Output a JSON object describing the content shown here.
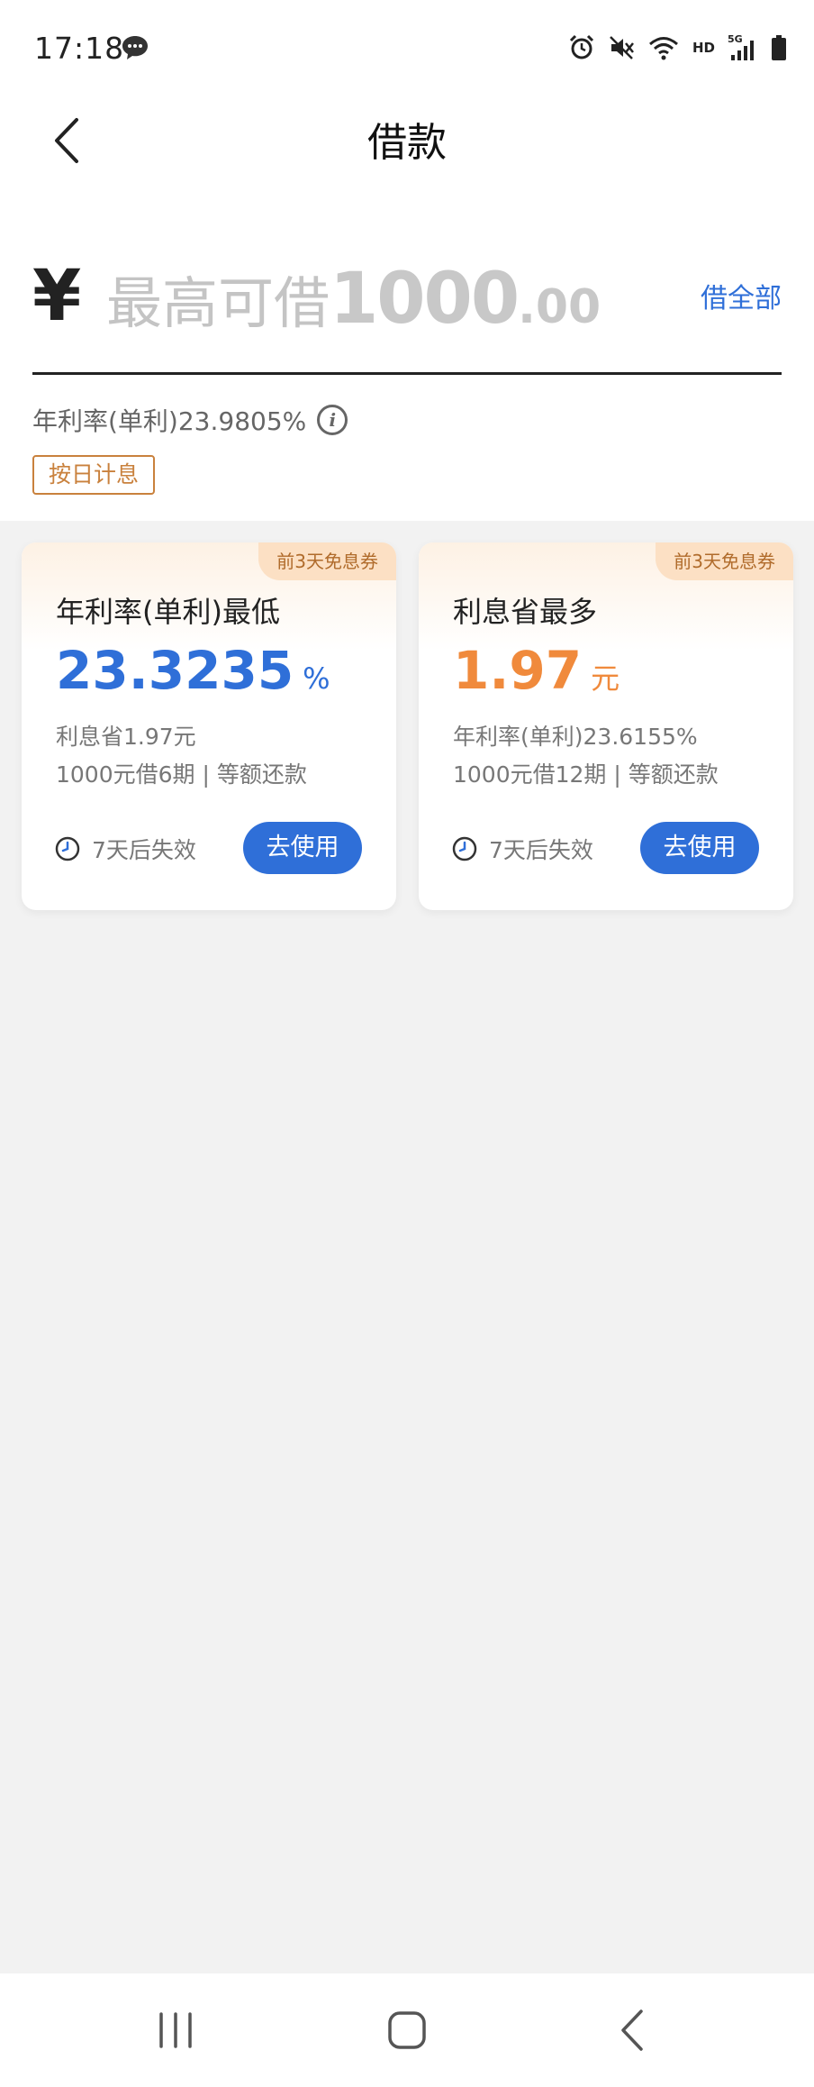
{
  "status_bar": {
    "time": "17:18",
    "network_label": "HD",
    "signal_label": "5G"
  },
  "nav": {
    "title": "借款"
  },
  "amount": {
    "currency_symbol": "¥",
    "placeholder_text": "最高可借",
    "placeholder_amount": "1000",
    "placeholder_decimal": ".00",
    "borrow_all_label": "借全部",
    "rate_text": "年利率(单利)23.9805%",
    "tag_label": "按日计息"
  },
  "cards": [
    {
      "badge": "前3天免息券",
      "title": "年利率(单利)最低",
      "main_value": "23.3235",
      "main_unit": "%",
      "line1": "利息省1.97元",
      "line2": "1000元借6期 | 等额还款",
      "expire": "7天后失效",
      "button": "去使用"
    },
    {
      "badge": "前3天免息券",
      "title": "利息省最多",
      "main_value": "1.97",
      "main_unit": "元",
      "line1": "年利率(单利)23.6155%",
      "line2": "1000元借12期 | 等额还款",
      "expire": "7天后失效",
      "button": "去使用"
    }
  ],
  "colors": {
    "accent_blue": "#2f6fd8",
    "accent_orange": "#f08a3c",
    "tag_orange": "#c9813d"
  }
}
